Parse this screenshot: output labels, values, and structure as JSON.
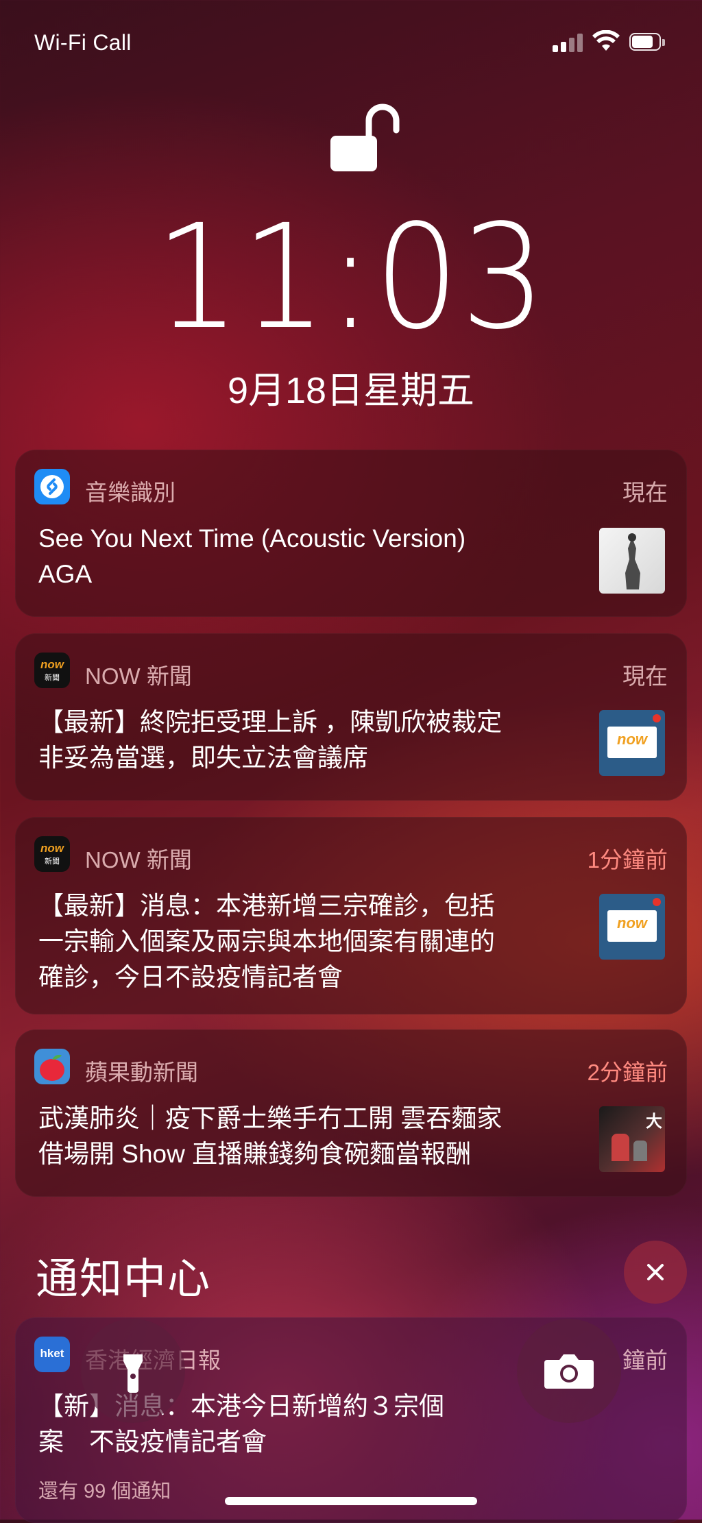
{
  "status_bar": {
    "carrier": "Wi-Fi Call"
  },
  "lock_screen": {
    "time": "11:03",
    "date": "9月18日星期五"
  },
  "notifications": [
    {
      "app": "音樂識別",
      "time": "現在",
      "title": "See You Next Time (Acoustic Version)",
      "subtitle": "AGA"
    },
    {
      "app": "NOW 新聞",
      "time": "現在",
      "lines": [
        "【最新】終院拒受理上訴 ，陳凱欣被裁定",
        "非妥為當選，即失立法會議席"
      ],
      "icon_text": "now",
      "icon_sub": "新聞",
      "thumb_text": "now"
    },
    {
      "app": "NOW 新聞",
      "time": "1分鐘前",
      "lines": [
        "【最新】消息：本港新增三宗確診，包括",
        "一宗輸入個案及兩宗與本地個案有關連的",
        "確診，今日不設疫情記者會"
      ],
      "icon_text": "now",
      "icon_sub": "新聞",
      "thumb_text": "now"
    },
    {
      "app": "蘋果動新聞",
      "time": "2分鐘前",
      "lines": [
        "武漢肺炎｜疫下爵士樂手冇工開 雲吞麵家",
        "借場開 Show 直播賺錢夠食碗麵當報酬"
      ],
      "thumb_text": "大"
    }
  ],
  "notification_center": {
    "title": "通知中心",
    "stack": {
      "icon_text": "hket",
      "app_visible": "香港經濟日報",
      "time_visible": "鐘前",
      "lines": [
        "【新】消息：本港今日新增約３宗個",
        "案　不設疫情記者會"
      ],
      "more": "還有 99 個通知"
    }
  },
  "colors": {
    "app_name": "#f2c9cc",
    "delayed_time": "#ff8a80",
    "shazam": "#1f8cf5",
    "now_orange": "#f0a020",
    "hket_blue": "#2a6fd6"
  }
}
